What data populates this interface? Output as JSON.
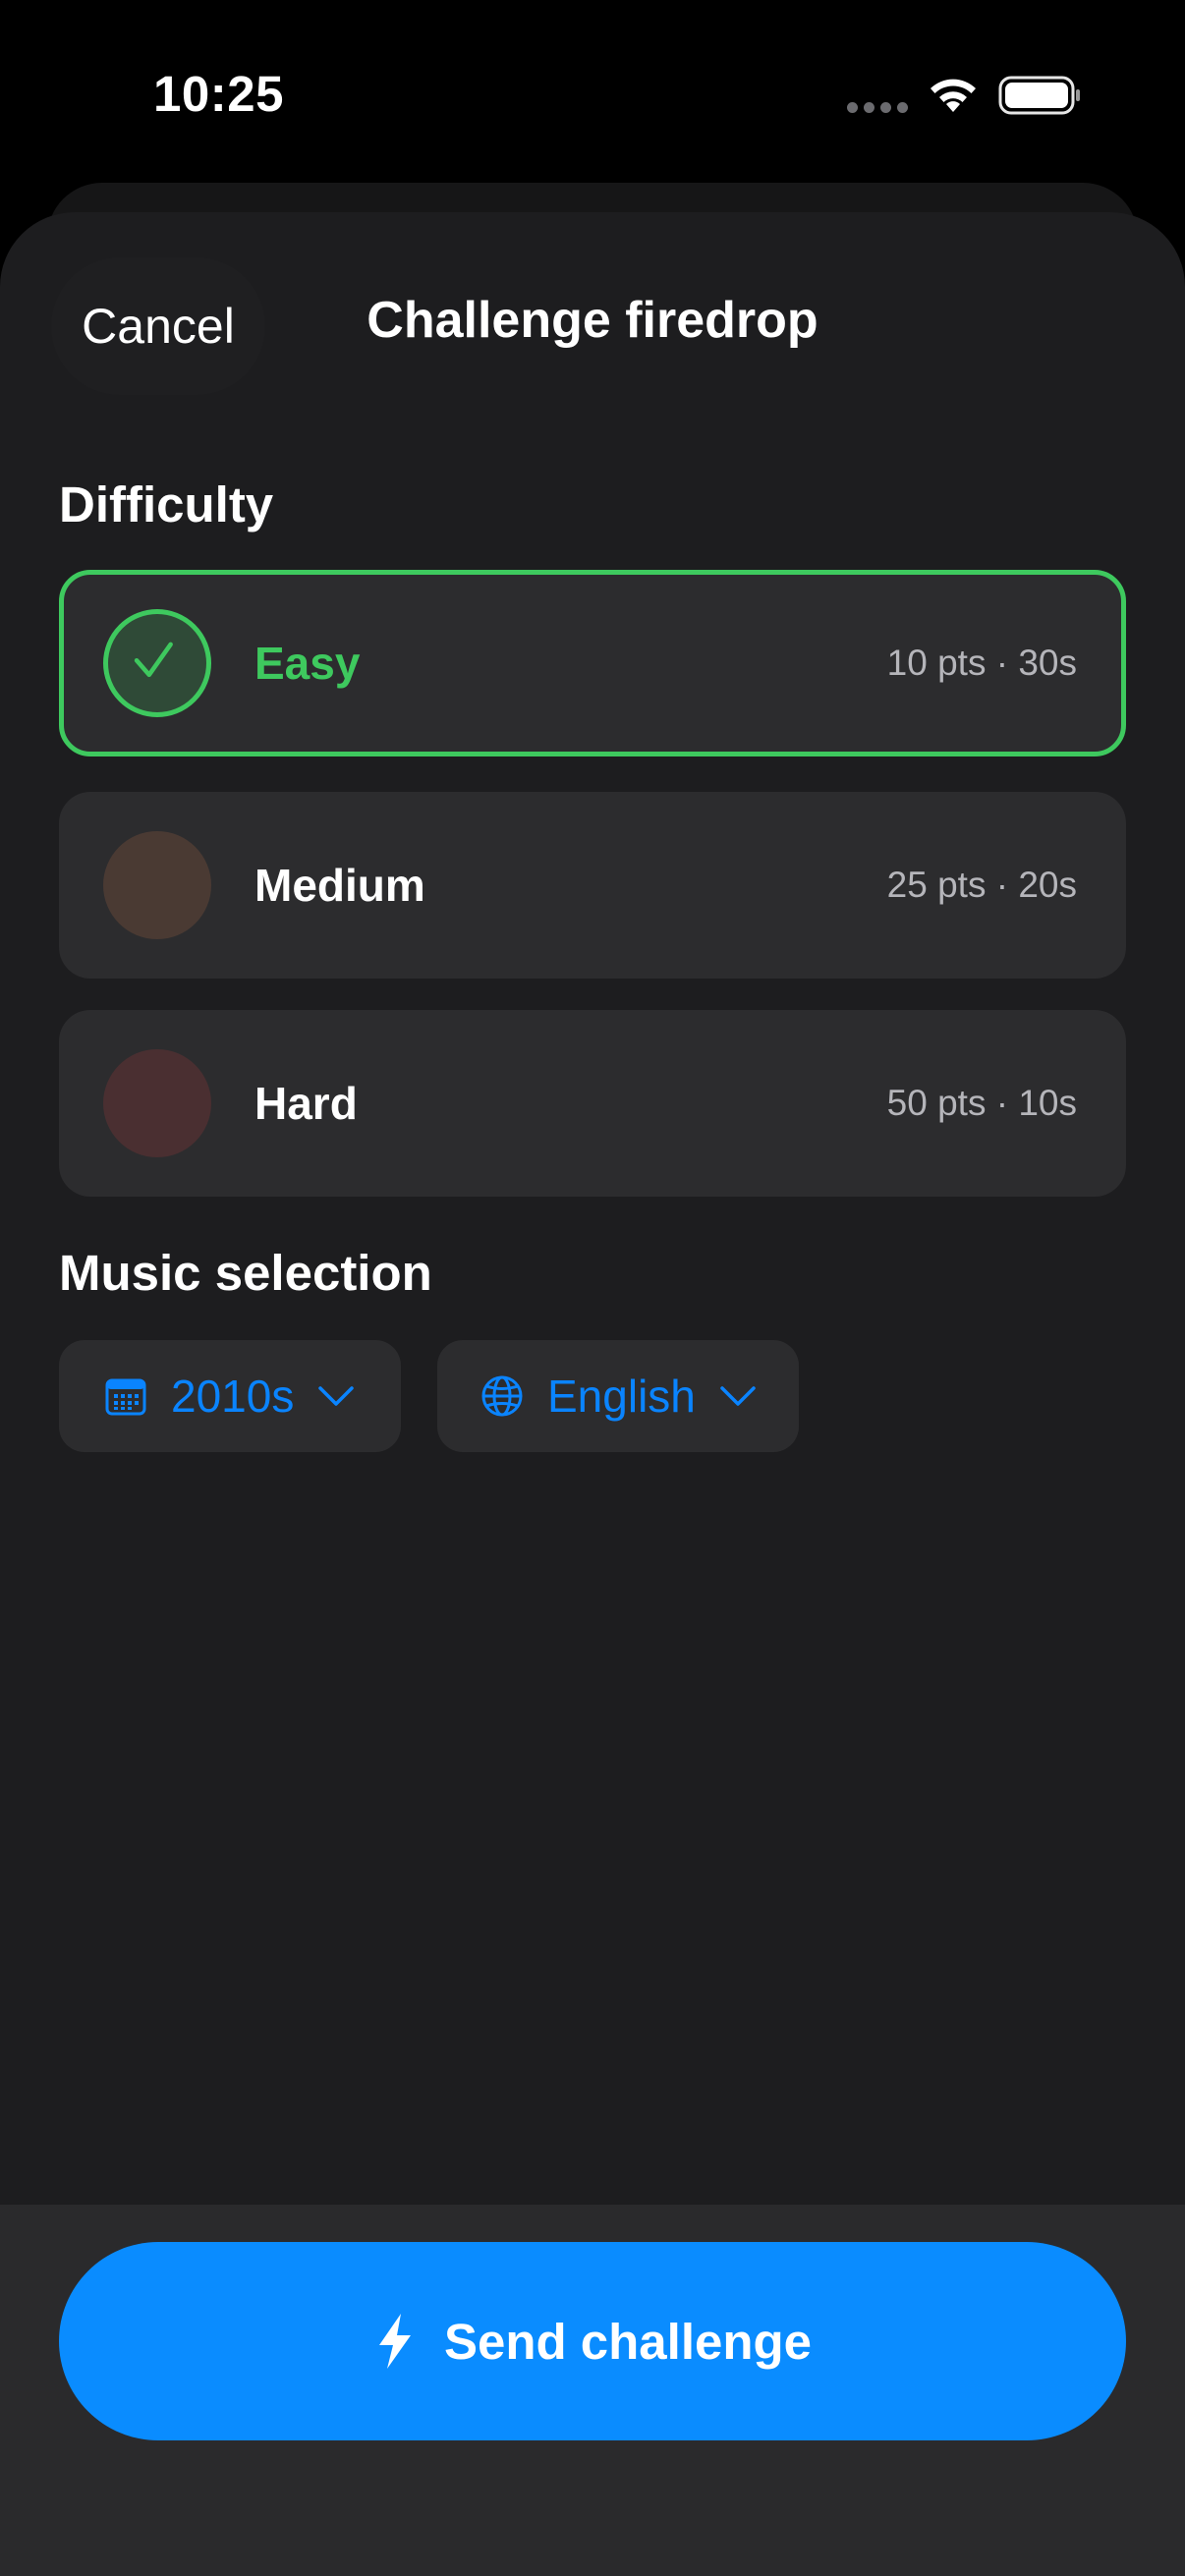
{
  "status_bar": {
    "time": "10:25"
  },
  "header": {
    "cancel_label": "Cancel",
    "title": "Challenge firedrop"
  },
  "difficulty": {
    "section_title": "Difficulty",
    "options": [
      {
        "label": "Easy",
        "meta": "10 pts · 30s",
        "selected": true,
        "color": "#3ec95e"
      },
      {
        "label": "Medium",
        "meta": "25 pts · 20s",
        "selected": false,
        "color": "#4a3a33"
      },
      {
        "label": "Hard",
        "meta": "50 pts · 10s",
        "selected": false,
        "color": "#4a2f31"
      }
    ]
  },
  "music": {
    "section_title": "Music selection",
    "decade": {
      "icon": "calendar-icon",
      "value": "2010s"
    },
    "language": {
      "icon": "globe-icon",
      "value": "English"
    }
  },
  "footer": {
    "send_label": "Send challenge",
    "icon": "bolt-icon"
  },
  "colors": {
    "accent_blue": "#0a84ff",
    "selected_green": "#3ec95e",
    "sheet_bg": "#1d1d1f",
    "card_bg": "#2c2c2e"
  }
}
